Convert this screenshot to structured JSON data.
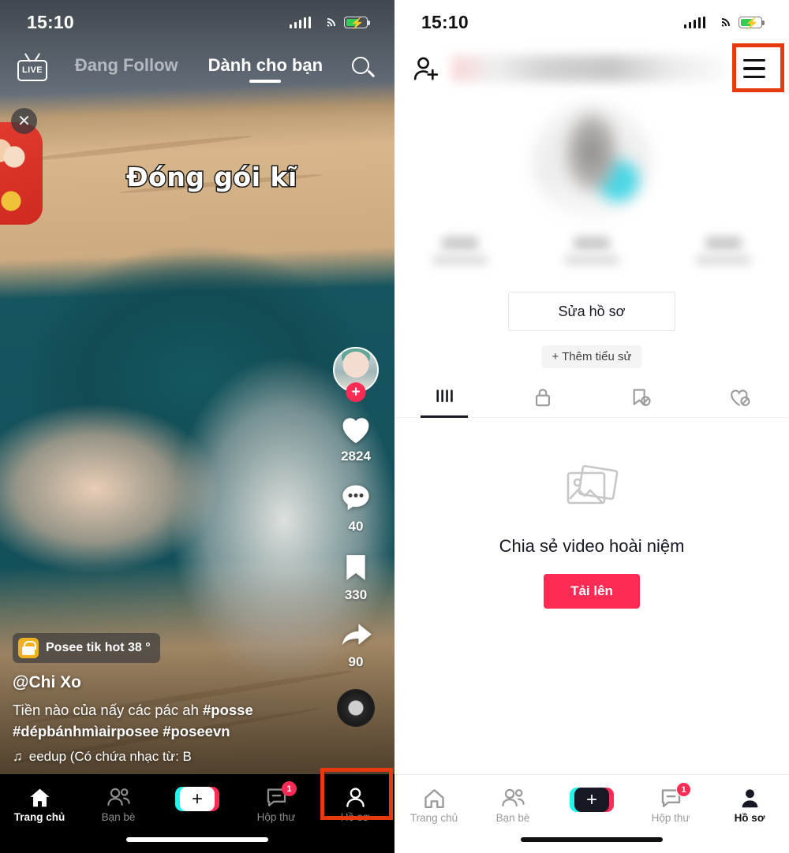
{
  "left_screen": {
    "status_bar": {
      "time": "15:10",
      "signal_icon": "signal-bars-icon",
      "wifi_icon": "wifi-icon",
      "battery_icon": "battery-charging-icon"
    },
    "header": {
      "live_label": "LIVE",
      "tabs": [
        {
          "label": "Đang Follow",
          "active": false
        },
        {
          "label": "Dành cho bạn",
          "active": true
        }
      ],
      "search_icon": "search-icon"
    },
    "video": {
      "close_icon": "close-icon",
      "overlay_text": "Đóng gói kĩ",
      "gift_icon": "gift-icon"
    },
    "action_rail": {
      "avatar_name": "creator-avatar",
      "follow_icon": "plus-follow-icon",
      "items": [
        {
          "icon": "heart-icon",
          "count": "2824"
        },
        {
          "icon": "comment-icon",
          "count": "40"
        },
        {
          "icon": "bookmark-icon",
          "count": "330"
        },
        {
          "icon": "share-icon",
          "count": "90"
        }
      ],
      "music_disc": "music-disc-icon"
    },
    "caption": {
      "shop_icon": "shopping-bag-icon",
      "shop_label": "Posee tik hot 38 °",
      "username": "@Chi Xo",
      "description_line1": "Tiền nào của nấy các pác ah ",
      "hashtag1": "#posse",
      "description_line2": "#dépbánhmìairposee #poseevn",
      "music_icon": "music-note-icon",
      "music_label": "eedup (Có chứa nhạc từ: B"
    },
    "bottom_nav": [
      {
        "label": "Trang chủ",
        "icon": "home-icon",
        "active": true,
        "badge": ""
      },
      {
        "label": "Bạn bè",
        "icon": "friends-icon",
        "active": false,
        "badge": ""
      },
      {
        "label": "",
        "icon": "create-plus-icon",
        "active": false,
        "badge": ""
      },
      {
        "label": "Hộp thư",
        "icon": "inbox-icon",
        "active": false,
        "badge": "1"
      },
      {
        "label": "Hồ sơ",
        "icon": "profile-icon",
        "active": false,
        "badge": ""
      }
    ]
  },
  "right_screen": {
    "status_bar": {
      "time": "15:10",
      "signal_icon": "signal-bars-icon",
      "wifi_icon": "wifi-icon",
      "battery_icon": "battery-charging-icon"
    },
    "header": {
      "add_friend_icon": "add-friend-icon",
      "username": "",
      "menu_icon": "hamburger-menu-icon"
    },
    "profile": {
      "avatar": "profile-avatar",
      "edit_profile_label": "Sửa hồ sơ",
      "add_bio_label": "+ Thêm tiểu sử"
    },
    "tabs": [
      {
        "icon": "grid-posts-icon",
        "active": true
      },
      {
        "icon": "lock-private-icon",
        "active": false
      },
      {
        "icon": "bookmark-hidden-icon",
        "active": false
      },
      {
        "icon": "heart-hidden-icon",
        "active": false
      }
    ],
    "empty_state": {
      "image_icon": "photos-stack-icon",
      "title": "Chia sẻ video hoài niệm",
      "upload_label": "Tải lên"
    },
    "bottom_nav": [
      {
        "label": "Trang chủ",
        "icon": "home-icon",
        "active": false,
        "badge": ""
      },
      {
        "label": "Bạn bè",
        "icon": "friends-icon",
        "active": false,
        "badge": ""
      },
      {
        "label": "",
        "icon": "create-plus-icon",
        "active": false,
        "badge": ""
      },
      {
        "label": "Hộp thư",
        "icon": "inbox-icon",
        "active": false,
        "badge": "1"
      },
      {
        "label": "Hồ sơ",
        "icon": "profile-icon",
        "active": true,
        "badge": ""
      }
    ]
  },
  "annotations": {
    "highlight_color": "#e8380d",
    "boxes": [
      "profile-nav-highlight",
      "hamburger-menu-highlight"
    ]
  }
}
